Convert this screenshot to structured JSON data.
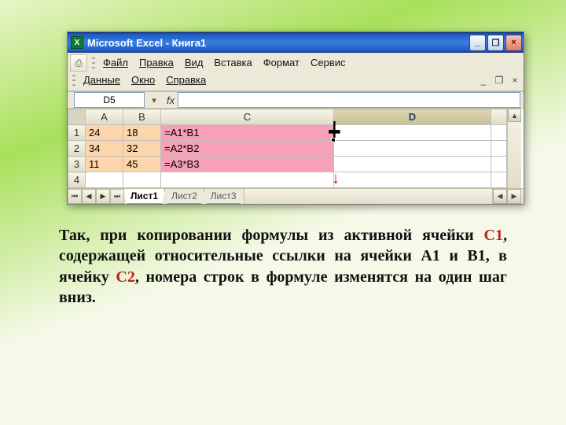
{
  "titlebar": {
    "appicon": "X",
    "text": "Microsoft Excel - Книга1"
  },
  "winbtn": {
    "min": "_",
    "max": "❐",
    "close": "×"
  },
  "menu": {
    "row1": [
      "Файл",
      "Правка",
      "Вид",
      "Вставка",
      "Формат",
      "Сервис"
    ],
    "row2": [
      "Данные",
      "Окно",
      "Справка"
    ],
    "mdi": {
      "min": "_",
      "max": "❐",
      "close": "×"
    },
    "tbicon": "⎙"
  },
  "formula": {
    "namebox": "D5",
    "fx": "fx",
    "dropdown": "▾",
    "value": ""
  },
  "columns": [
    "A",
    "B",
    "C",
    "D",
    ""
  ],
  "rows": [
    {
      "h": "1",
      "a": "24",
      "b": "18",
      "c": "=A1*B1",
      "d": "",
      "drag": "cross",
      "fillhandle": true
    },
    {
      "h": "2",
      "a": "34",
      "b": "32",
      "c": "=A2*B2",
      "d": ""
    },
    {
      "h": "3",
      "a": "11",
      "b": "45",
      "c": "=A3*B3",
      "d": "",
      "drag": "downarrow"
    },
    {
      "h": "4",
      "a": "",
      "b": "",
      "c": "",
      "d": "",
      "plain": true
    }
  ],
  "tabs": {
    "active": "Лист1",
    "others": [
      "Лист2",
      "Лист3"
    ],
    "nav": [
      "⏮",
      "◀",
      "▶",
      "⏭"
    ],
    "scroll": {
      "up": "▲",
      "left": "◀",
      "right": "▶"
    }
  },
  "caption": {
    "pre": "Так, при копировании формулы из активной ячейки ",
    "c1": "С1",
    "mid": ", содержащей относительные ссылки на ячейки А1 и В1, в ячейку ",
    "c2": "С2",
    "post": ", номера строк в формуле изменятся на один шаг вниз."
  }
}
